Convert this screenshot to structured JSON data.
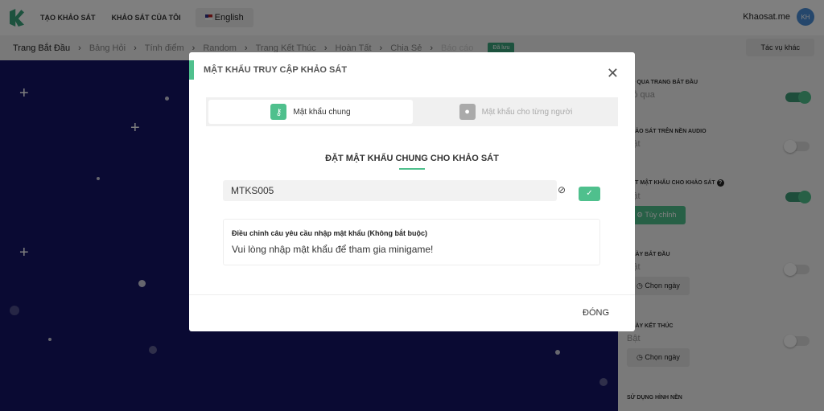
{
  "topbar": {
    "nav": [
      "TẠO KHẢO SÁT",
      "KHẢO SÁT CỦA TÔI"
    ],
    "language": "English",
    "brand": "Khaosat.me",
    "avatar": "KH"
  },
  "breadcrumb": {
    "items": [
      "Trang Bắt Đầu",
      "Bảng Hỏi",
      "Tính điểm",
      "Random",
      "Trang Kết Thúc",
      "Hoàn Tất",
      "Chia Sẻ",
      "Báo cáo"
    ],
    "saved": "Đã lưu",
    "more": "Tác vụ khác"
  },
  "panel": {
    "sections": [
      {
        "title": "BỎ QUA TRANG BẮT ĐẦU",
        "status": "Bỏ qua",
        "on": true
      },
      {
        "title": "KHẢO SÁT TRÊN NỀN AUDIO",
        "status": "Bật",
        "on": false
      },
      {
        "title": "ĐẶT MẬT KHẨU CHO KHẢO SÁT",
        "status": "Bật",
        "on": true,
        "button": "Tùy chỉnh"
      },
      {
        "title": "NGÀY BẮT ĐẦU",
        "status": "Bật",
        "on": false,
        "button": "Chọn ngày"
      },
      {
        "title": "NGÀY KẾT THÚC",
        "status": "Bật",
        "on": false,
        "button": "Chọn ngày"
      },
      {
        "title": "SỬ DỤNG HÌNH NỀN"
      }
    ]
  },
  "modal": {
    "title": "MẬT KHẨU TRUY CẬP KHẢO SÁT",
    "tabs": [
      {
        "label": "Mật khẩu chung",
        "icon": "key-icon"
      },
      {
        "label": "Mật khẩu cho từng người",
        "icon": "user-icon"
      }
    ],
    "heading": "ĐẶT MẬT KHẨU CHUNG CHO KHẢO SÁT",
    "password": "MTKS005",
    "prompt_label": "Điều chỉnh câu yêu cầu nhập mật khẩu (Không bắt buộc)",
    "prompt_value": "Vui lòng nhập mật khẩu để tham gia minigame!",
    "close_label": "ĐÓNG"
  },
  "colors": {
    "accent": "#4fc08d",
    "canvas": "#151566"
  }
}
